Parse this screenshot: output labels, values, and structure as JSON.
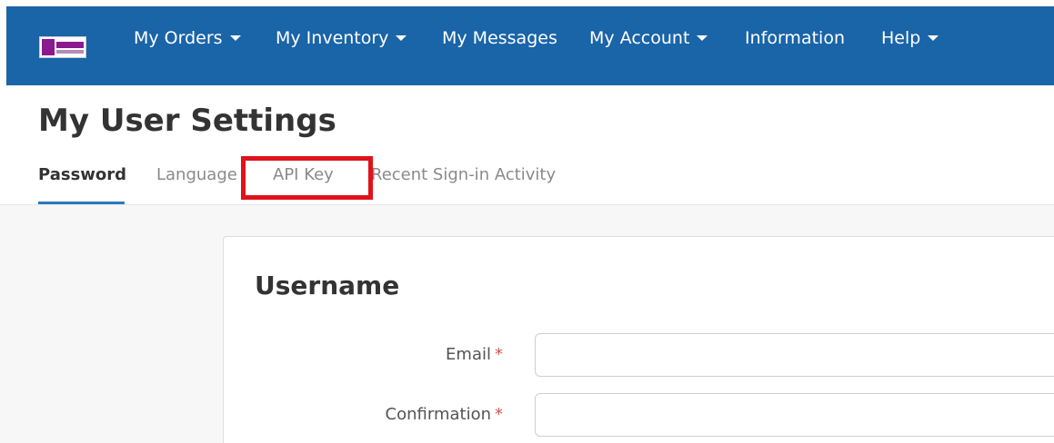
{
  "header": {
    "logo_icon": "game-logo-icon",
    "brand_color": "#1a64a8",
    "nav": [
      {
        "label": "My Orders",
        "dropdown": true
      },
      {
        "label": "My Inventory",
        "dropdown": true
      },
      {
        "label": "My Messages",
        "dropdown": false
      },
      {
        "label": "My Account",
        "dropdown": true
      },
      {
        "label": "Information",
        "dropdown": false
      },
      {
        "label": "Help",
        "dropdown": true
      }
    ]
  },
  "page": {
    "title": "My User Settings"
  },
  "tabs": [
    {
      "label": "Password",
      "active": true
    },
    {
      "label": "Language",
      "active": false
    },
    {
      "label": "API Key",
      "active": false,
      "highlighted": true
    },
    {
      "label": "Recent Sign-in Activity",
      "active": false
    }
  ],
  "highlight_color": "#e0121c",
  "card": {
    "title": "Username",
    "fields": [
      {
        "label": "Email",
        "required_mark": "*",
        "value": ""
      },
      {
        "label": "Confirmation",
        "required_mark": "*",
        "value": ""
      }
    ]
  }
}
